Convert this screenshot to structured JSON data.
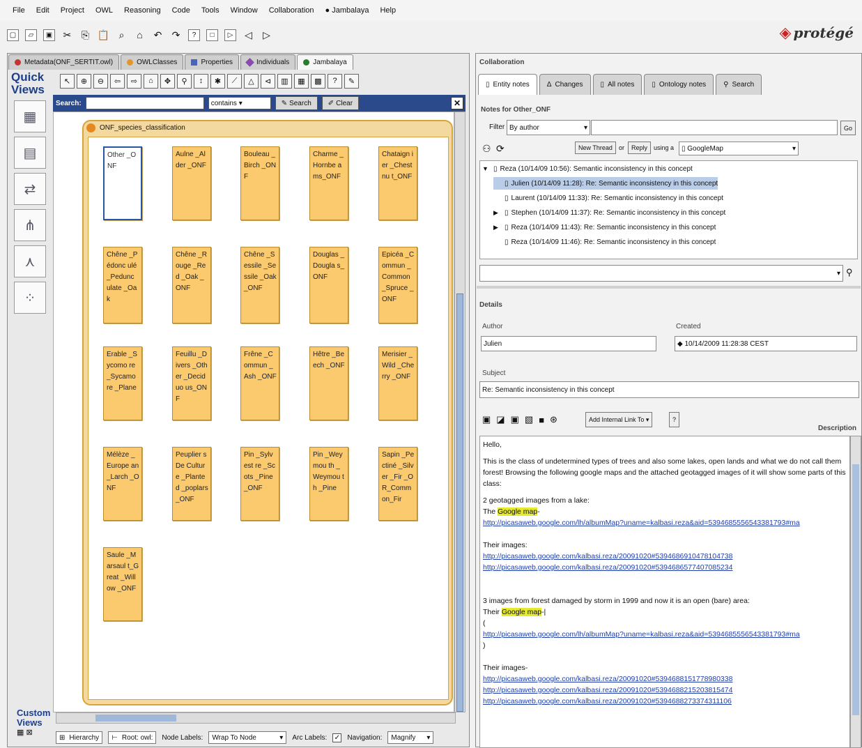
{
  "menu": [
    "File",
    "Edit",
    "Project",
    "OWL",
    "Reasoning",
    "Code",
    "Tools",
    "Window",
    "Collaboration",
    "Jambalaya",
    "Help"
  ],
  "logo": "protégé",
  "left_tabs": [
    {
      "label": "Metadata(ONF_SERTIT.owl)",
      "color": "#c63434"
    },
    {
      "label": "OWLClasses",
      "color": "#e0982e"
    },
    {
      "label": "Properties",
      "color": "#4a64b8"
    },
    {
      "label": "Individuals",
      "color": "#8a4ab3"
    },
    {
      "label": "Jambalaya",
      "color": "#2a7b2a"
    }
  ],
  "quick_views": "Quick Views",
  "custom_views": "Custom Views",
  "search": {
    "label": "Search:",
    "mode": "contains",
    "search_button": "Search",
    "clear_button": "Clear"
  },
  "group_title": "ONF_species_classification",
  "nodes": [
    "Other _ONF",
    "Aulne _Alder _ONF",
    "Bouleau _Birch _ONF",
    "Charme _Hornbe ams_ONF",
    "Chataign ier _Chestnu t_ONF",
    "Chêne _Pédonc ulé _Pedunc ulate _Oak",
    "Chêne _Rouge _Red _Oak _ONF",
    "Chêne _Sessile _Sessile _Oak_ONF",
    "Douglas _Dougla s_ONF",
    "Epicéa _Commun _Common _Spruce _ONF",
    "Erable _Sycomo re _Sycamo re _Plane",
    "Feuillu _Divers _Other _Deciduo us_ONF",
    "Frêne _Commun _Ash _ONF",
    "Hêtre _Beech _ONF",
    "Merisier _Wild _Cherry _ONF",
    "Mélèze _Europe an _Larch _ONF",
    "Peuplier sDe Culture _Planted _poplars _ONF",
    "Pin _Sylvest re _Scots _Pine _ONF",
    "Pin _Weymou th _Weymou th _Pine",
    "Sapin _Pectiné _Silver _Fir _OR_Comm on_Fir",
    "Saule _Marsaul t_Great _Willow _ONF"
  ],
  "bottom": {
    "hierarchy": "Hierarchy",
    "root": "Root: owl:",
    "node_labels_label": "Node Labels:",
    "node_labels_value": "Wrap To Node",
    "arc_labels_label": "Arc Labels:",
    "navigation_label": "Navigation:",
    "navigation_value": "Magnify"
  },
  "collaboration": {
    "title": "Collaboration",
    "tabs": [
      "Entity notes",
      "Changes",
      "All notes",
      "Ontology notes",
      "Search"
    ],
    "notes_for": "Notes for Other_ONF",
    "filter_label": "Filter",
    "filter_value": "By author",
    "go": "Go",
    "new_thread": "New Thread",
    "or": "or",
    "reply": "Reply",
    "using_a": "using a",
    "using_value": "GoogleMap",
    "threads": [
      {
        "text": "Reza (10/14/09 10:56): Semantic inconsistency in this concept",
        "level": 0,
        "arrow": "▼",
        "selected": false
      },
      {
        "text": "Julien (10/14/09 11:28): Re: Semantic inconsistency in this concept",
        "level": 1,
        "arrow": "",
        "selected": true
      },
      {
        "text": "Laurent (10/14/09 11:33): Re: Semantic inconsistency in this concept",
        "level": 1,
        "arrow": "",
        "selected": false
      },
      {
        "text": "Stephen (10/14/09 11:37): Re: Semantic inconsistency in this concept",
        "level": 1,
        "arrow": "▶",
        "selected": false
      },
      {
        "text": "Reza (10/14/09 11:43): Re: Semantic inconsistency in this concept",
        "level": 1,
        "arrow": "▶",
        "selected": false
      },
      {
        "text": "Reza (10/14/09 11:46): Re: Semantic inconsistency in this concept",
        "level": 1,
        "arrow": "",
        "selected": false
      }
    ]
  },
  "details": {
    "title": "Details",
    "author_label": "Author",
    "author_value": "Julien",
    "created_label": "Created",
    "created_value": "10/14/2009 11:28:38 CEST",
    "subject_label": "Subject",
    "subject_value": "Re: Semantic inconsistency in this concept",
    "add_internal_link": "Add Internal Link To",
    "help": "?",
    "description_label": "Description"
  },
  "description": {
    "greeting": "Hello,",
    "intro": "This is the class of undetermined types of trees and also some lakes, open lands and what we do not call them forest! Browsing the following google maps and the attached geotagged images of it will show some parts of this class:",
    "lake_heading": "2 geotagged images from a lake:",
    "the": "The",
    "google_map": "Google map",
    "lake_map_link": "http://picasaweb.google.com/lh/albumMap?uname=kalbasi.reza&aid=5394685556543381793#ma",
    "their_images": "Their images:",
    "lake_images": [
      "http://picasaweb.google.com/kalbasi.reza/20091020#5394686910478104738",
      "http://picasaweb.google.com/kalbasi.reza/20091020#5394686577407085234"
    ],
    "forest_heading": "3 images from forest damaged by storm in 1999 and now it is an open (bare) area:",
    "their": "Their",
    "open_paren": "(",
    "forest_map_link": "http://picasaweb.google.com/lh/albumMap?uname=kalbasi.reza&aid=5394685556543381793#ma",
    "close_paren": ")",
    "their_images2": "Their images-",
    "forest_images": [
      "http://picasaweb.google.com/kalbasi.reza/20091020#5394688151778980338",
      "http://picasaweb.google.com/kalbasi.reza/20091020#5394688215203815474",
      "http://picasaweb.google.com/kalbasi.reza/20091020#5394688273374311106"
    ]
  }
}
